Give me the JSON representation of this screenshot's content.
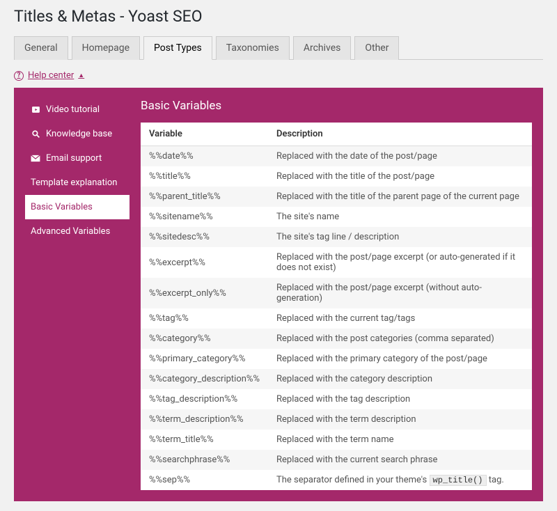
{
  "page_title": "Titles & Metas - Yoast SEO",
  "tabs": [
    "General",
    "Homepage",
    "Post Types",
    "Taxonomies",
    "Archives",
    "Other"
  ],
  "active_tab_index": 2,
  "help_center_label": "Help center",
  "sidebar": {
    "items": [
      {
        "label": "Video tutorial",
        "icon": "play"
      },
      {
        "label": "Knowledge base",
        "icon": "search"
      },
      {
        "label": "Email support",
        "icon": "mail"
      },
      {
        "label": "Template explanation"
      },
      {
        "label": "Basic Variables"
      },
      {
        "label": "Advanced Variables"
      }
    ],
    "active_index": 4
  },
  "content": {
    "title": "Basic Variables",
    "columns": [
      "Variable",
      "Description"
    ],
    "rows": [
      {
        "var": "%%date%%",
        "desc": "Replaced with the date of the post/page"
      },
      {
        "var": "%%title%%",
        "desc": "Replaced with the title of the post/page"
      },
      {
        "var": "%%parent_title%%",
        "desc": "Replaced with the title of the parent page of the current page"
      },
      {
        "var": "%%sitename%%",
        "desc": "The site's name"
      },
      {
        "var": "%%sitedesc%%",
        "desc": "The site's tag line / description"
      },
      {
        "var": "%%excerpt%%",
        "desc": "Replaced with the post/page excerpt (or auto-generated if it does not exist)"
      },
      {
        "var": "%%excerpt_only%%",
        "desc": "Replaced with the post/page excerpt (without auto-generation)"
      },
      {
        "var": "%%tag%%",
        "desc": "Replaced with the current tag/tags"
      },
      {
        "var": "%%category%%",
        "desc": "Replaced with the post categories (comma separated)"
      },
      {
        "var": "%%primary_category%%",
        "desc": "Replaced with the primary category of the post/page"
      },
      {
        "var": "%%category_description%%",
        "desc": "Replaced with the category description"
      },
      {
        "var": "%%tag_description%%",
        "desc": "Replaced with the tag description"
      },
      {
        "var": "%%term_description%%",
        "desc": "Replaced with the term description"
      },
      {
        "var": "%%term_title%%",
        "desc": "Replaced with the term name"
      },
      {
        "var": "%%searchphrase%%",
        "desc": "Replaced with the current search phrase"
      },
      {
        "var": "%%sep%%",
        "desc": "The separator defined in your theme's ",
        "code": "wp_title()",
        "desc_after": " tag."
      }
    ]
  }
}
